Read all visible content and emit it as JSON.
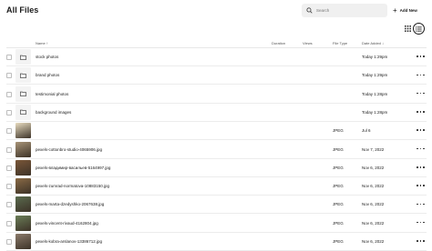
{
  "page": {
    "title": "All Files"
  },
  "search": {
    "placeholder": "Search"
  },
  "toolbar": {
    "add_label": "Add New"
  },
  "view_toggle": {
    "grid_icon": "grid-icon",
    "list_icon": "list-icon",
    "active": "list"
  },
  "columns": {
    "name": "Name ↑",
    "duration": "Duration",
    "views": "Views",
    "file_type": "File Type",
    "date_added": "Date Added ↓"
  },
  "rows": [
    {
      "kind": "folder",
      "name": "stock photos",
      "type": "",
      "date": "Today 1:29pm"
    },
    {
      "kind": "folder",
      "name": "brand photos",
      "type": "",
      "date": "Today 1:29pm"
    },
    {
      "kind": "folder",
      "name": "testimonial photos",
      "type": "",
      "date": "Today 1:28pm"
    },
    {
      "kind": "folder",
      "name": "background images",
      "type": "",
      "date": "Today 1:28pm"
    },
    {
      "kind": "image",
      "name": "",
      "type": "JPEG",
      "date": "Jul 6",
      "thumb_color": "#e8dcc0"
    },
    {
      "kind": "image",
      "name": "pexels-cottonbro-studio-4065906.jpg",
      "type": "JPEG",
      "date": "Nov 7, 2022",
      "thumb_color": "#a89478"
    },
    {
      "kind": "image",
      "name": "pexels-владимир-васильев-5164997.jpg",
      "type": "JPEG",
      "date": "Nov 6, 2022",
      "thumb_color": "#7a5638"
    },
    {
      "kind": "image",
      "name": "pexels-zumrad-normatova-10883150.jpg",
      "type": "JPEG",
      "date": "Nov 6, 2022",
      "thumb_color": "#8a6a45"
    },
    {
      "kind": "image",
      "name": "pexels-marta-dzedyshko-2067638.jpg",
      "type": "JPEG",
      "date": "Nov 6, 2022",
      "thumb_color": "#5a6b4e"
    },
    {
      "kind": "image",
      "name": "pexels-vincent-rivaud-4162804.jpg",
      "type": "JPEG",
      "date": "Nov 6, 2022",
      "thumb_color": "#6a7d57"
    },
    {
      "kind": "image",
      "name": "pexels-kobra-arslanov-13386712.jpg",
      "type": "JPEG",
      "date": "Nov 6, 2022",
      "thumb_color": "#8b7a6a"
    }
  ]
}
